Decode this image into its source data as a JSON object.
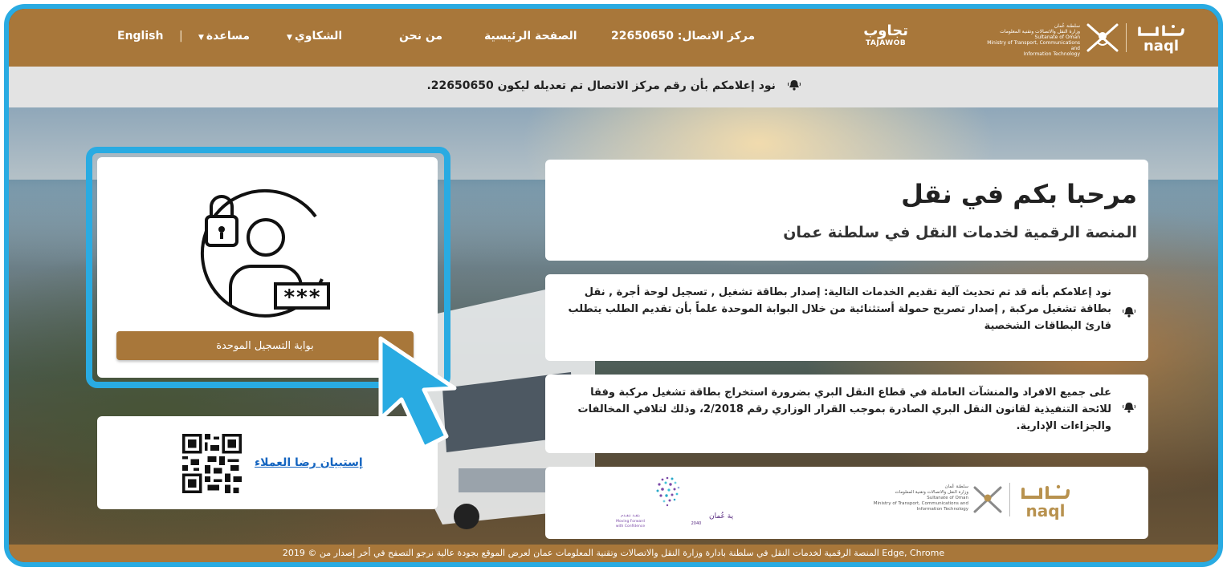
{
  "nav": {
    "english": "English",
    "separator": "|",
    "help": "مساعدة",
    "complaints": "الشكاوي",
    "about": "من نحن",
    "home": "الصفحة الرئيسية",
    "contact": "مركز الاتصال: 22650650",
    "tajawob_ar": "تجاوب",
    "tajawob_en": "TAJAWOB",
    "ministry_lines": [
      "سلطنة عُمان",
      "وزارة النقل والاتصالات وتقنية المعلومات",
      "Sultanate of Oman",
      "Ministry of Transport, Communications and",
      "Information Technology"
    ],
    "brand_en": "naql"
  },
  "notice": {
    "text": "نود إعلامكم بأن رقم مركز الاتصال تم تعديله ليكون 22650650."
  },
  "login": {
    "button_label": "بوابة التسجيل الموحدة",
    "password_mask": "***"
  },
  "survey": {
    "link_label": "إستبيان رضا العملاء"
  },
  "welcome": {
    "title": "مرحبا بكم في نقل",
    "subtitle": "المنصة الرقمية لخدمات النقل في سلطنة عمان"
  },
  "announcements": [
    {
      "text": "نود إعلامكم بأنه قد تم تحديث آلية تقديم الخدمات التالية: إصدار بطاقة تشغيل , تسجيل لوحة أجرة , نقل بطاقة تشغيل مركبة , إصدار تصريح حمولة أستثنائية من خلال البوابة الموحدة علماً بأن تقديم الطلب يتطلب قارئ البطاقات الشخصية"
    },
    {
      "text": "على جميع الافراد والمنشآت العاملة في قطاع النقل البري بضرورة استخراج بطاقة تشغيل مركبة وفقا للائحة التنفيذية لقانون النقل البري الصادرة بموجب القرار الوزاري رقم 2/2018، وذلك لتلافي المخالفات والجزاءات الإدارية."
    }
  ],
  "logos": {
    "ministry_lines": [
      "سلطنة عُمان",
      "وزارة النقل والاتصالات وتقنية المعلومات",
      "Sultanate of Oman",
      "Ministry of Transport, Communications and",
      "Information Technology"
    ],
    "brand_en": "naql",
    "vision_ar": "رؤية عُمان",
    "vision_year": "2040",
    "vision_tag1": "بثقـة نتقـدم",
    "vision_tag2": "Moving Forward",
    "vision_tag3": "with Confidence"
  },
  "footer": {
    "text": "2019 © المنصة الرقمية لخدمات النقل في سلطنة بادارة وزارة النقل والاتصالات وتقنية المعلومات عمان لعرض الموقع بجودة عالية نرجو التصفح في أخر إصدار من Edge, Chrome"
  },
  "colors": {
    "brand_brown": "#a8773a",
    "highlight_blue": "#29abe2",
    "link_blue": "#1565c0"
  }
}
